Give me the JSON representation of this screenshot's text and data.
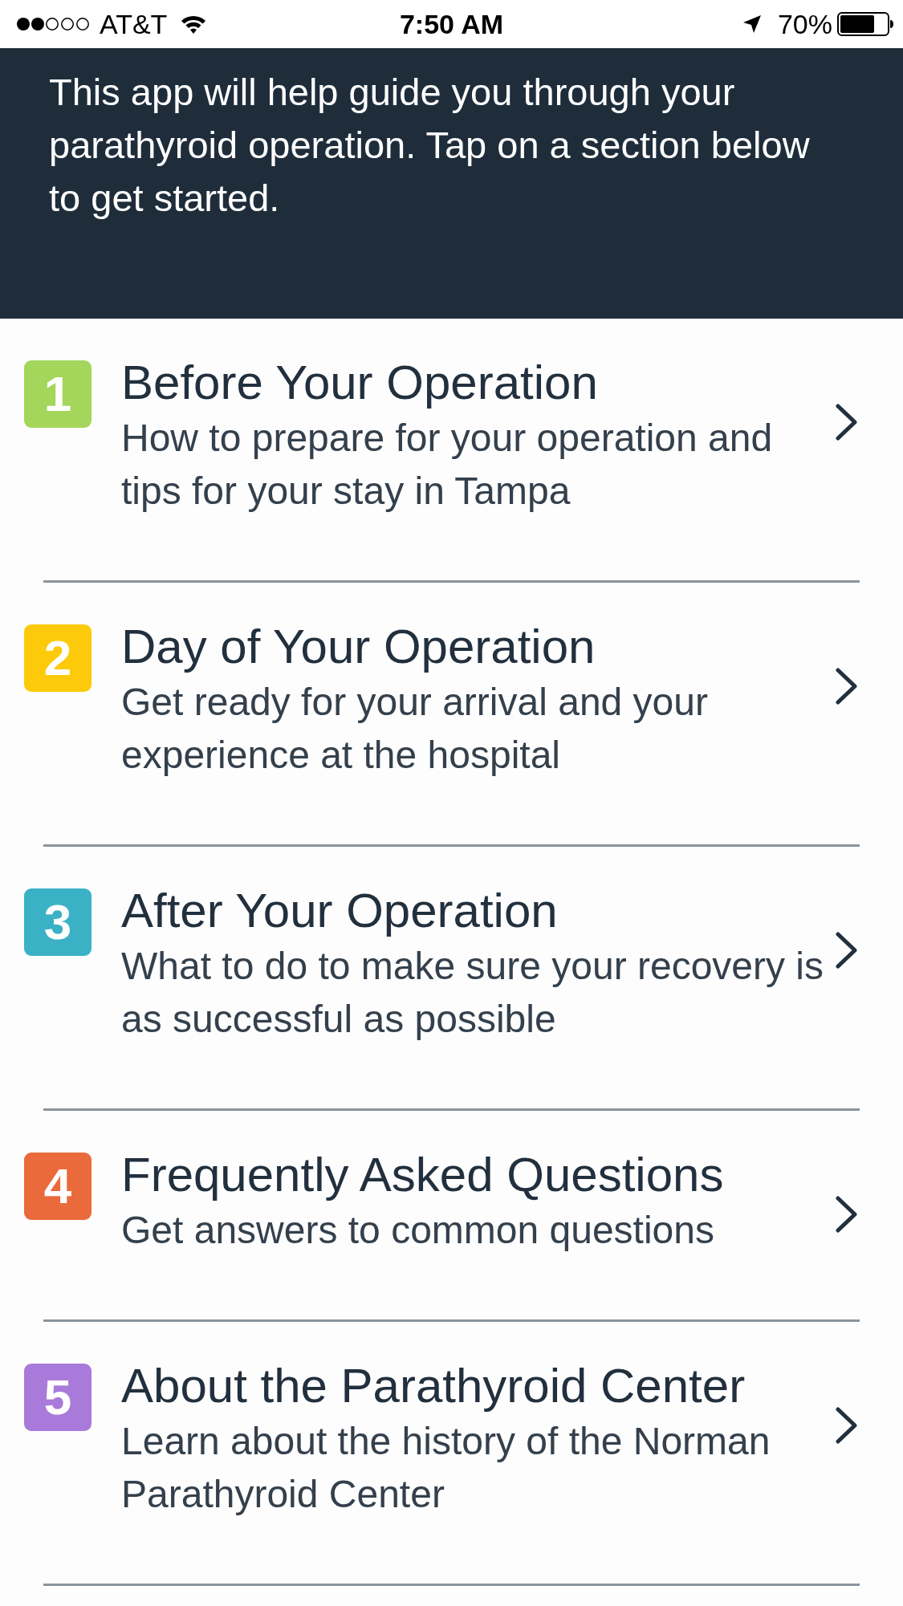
{
  "status_bar": {
    "carrier": "AT&T",
    "time": "7:50 AM",
    "battery": "70%"
  },
  "intro": {
    "text": "This app will help guide you through your parathyroid operation. Tap on a section below to get started."
  },
  "sections": [
    {
      "number": "1",
      "title": "Before Your Operation",
      "subtitle": "How to prepare for your operation and tips for your stay in Tampa",
      "color": "#a3d65a"
    },
    {
      "number": "2",
      "title": "Day of Your Operation",
      "subtitle": "Get ready for your arrival and your experience at the hospital",
      "color": "#fdca0b"
    },
    {
      "number": "3",
      "title": "After Your Operation",
      "subtitle": "What to do to make sure your recovery is as successful as possible",
      "color": "#3bb1c6"
    },
    {
      "number": "4",
      "title": "Frequently Asked Questions",
      "subtitle": "Get answers to common questions",
      "color": "#ea6a3b"
    },
    {
      "number": "5",
      "title": "About the Parathyroid Center",
      "subtitle": "Learn about the history of the Norman Parathyroid Center",
      "color": "#a97ad9"
    }
  ]
}
